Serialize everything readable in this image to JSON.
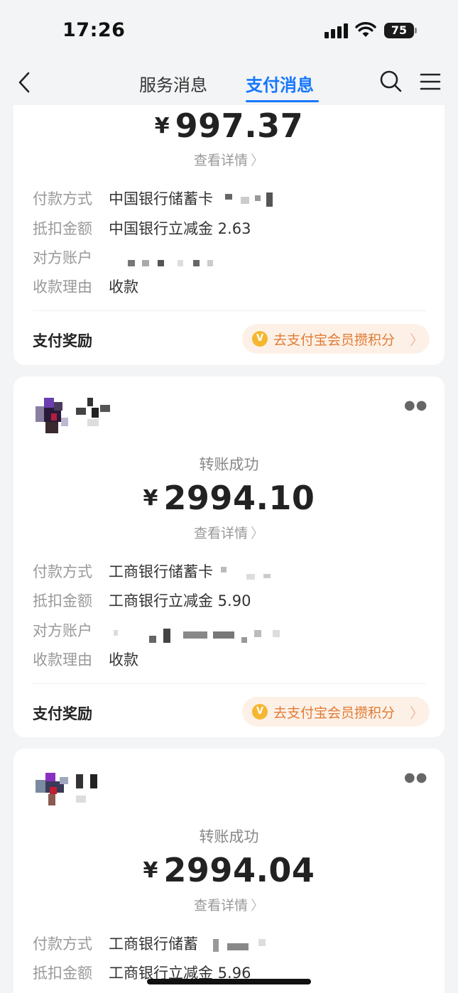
{
  "status_bar": {
    "time": "17:26",
    "battery": "75"
  },
  "nav": {
    "tabs": [
      {
        "label": "服务消息"
      },
      {
        "label": "支付消息"
      }
    ]
  },
  "cards": [
    {
      "amount": "997.37",
      "currency": "¥",
      "detail_link": "查看详情",
      "rows": [
        {
          "key": "付款方式",
          "value": "中国银行储蓄卡"
        },
        {
          "key": "抵扣金额",
          "value": "中国银行立减金 2.63"
        },
        {
          "key": "对方账户",
          "value": ""
        },
        {
          "key": "收款理由",
          "value": "收款"
        }
      ],
      "reward_label": "支付奖励",
      "reward_button": "去支付宝会员攒积分"
    },
    {
      "status": "转账成功",
      "amount": "2994.10",
      "currency": "¥",
      "detail_link": "查看详情",
      "rows": [
        {
          "key": "付款方式",
          "value": "工商银行储蓄卡"
        },
        {
          "key": "抵扣金额",
          "value": "工商银行立减金 5.90"
        },
        {
          "key": "对方账户",
          "value": ""
        },
        {
          "key": "收款理由",
          "value": "收款"
        }
      ],
      "reward_label": "支付奖励",
      "reward_button": "去支付宝会员攒积分"
    },
    {
      "status": "转账成功",
      "amount": "2994.04",
      "currency": "¥",
      "detail_link": "查看详情",
      "rows": [
        {
          "key": "付款方式",
          "value": "工商银行储蓄"
        },
        {
          "key": "抵扣金额",
          "value": "工商银行立减金 5.96"
        }
      ]
    }
  ],
  "colors": {
    "accent": "#1677ff",
    "reward_text": "#e07b35",
    "reward_bg": "#fdf1e7"
  },
  "icons": [
    "back-arrow-icon",
    "search-icon",
    "menu-icon",
    "wifi-icon",
    "signal-icon",
    "more-icon",
    "coin-icon"
  ]
}
